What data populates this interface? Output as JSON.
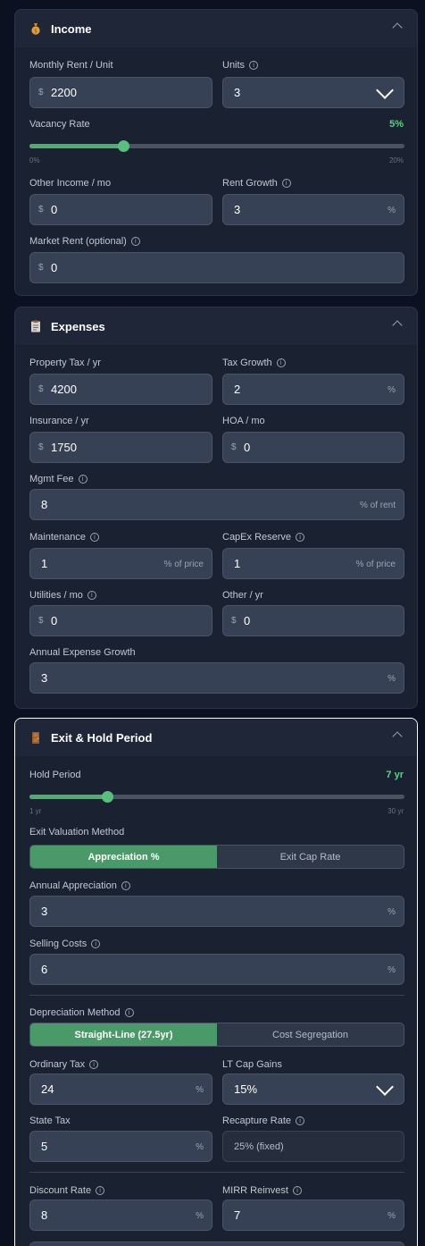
{
  "income": {
    "title": "Income",
    "icon": "money-bag-icon",
    "monthly_rent_label": "Monthly Rent / Unit",
    "monthly_rent_prefix": "$",
    "monthly_rent_value": "2200",
    "units_label": "Units",
    "units_value": "3",
    "vacancy_label": "Vacancy Rate",
    "vacancy_value_text": "5%",
    "vacancy_fraction": 0.25,
    "vacancy_min": "0%",
    "vacancy_max": "20%",
    "other_income_label": "Other Income / mo",
    "other_income_prefix": "$",
    "other_income_value": "0",
    "rent_growth_label": "Rent Growth",
    "rent_growth_value": "3",
    "rent_growth_suffix": "%",
    "market_rent_label": "Market Rent (optional)",
    "market_rent_prefix": "$",
    "market_rent_value": "0"
  },
  "expenses": {
    "title": "Expenses",
    "icon": "clipboard-icon",
    "property_tax_label": "Property Tax / yr",
    "property_tax_prefix": "$",
    "property_tax_value": "4200",
    "tax_growth_label": "Tax Growth",
    "tax_growth_value": "2",
    "tax_growth_suffix": "%",
    "insurance_label": "Insurance / yr",
    "insurance_prefix": "$",
    "insurance_value": "1750",
    "hoa_label": "HOA / mo",
    "hoa_prefix": "$",
    "hoa_value": "0",
    "mgmt_fee_label": "Mgmt Fee",
    "mgmt_fee_value": "8",
    "mgmt_fee_suffix": "% of rent",
    "maintenance_label": "Maintenance",
    "maintenance_value": "1",
    "maintenance_suffix": "% of price",
    "capex_label": "CapEx Reserve",
    "capex_value": "1",
    "capex_suffix": "% of price",
    "utilities_label": "Utilities / mo",
    "utilities_prefix": "$",
    "utilities_value": "0",
    "other_label": "Other / yr",
    "other_prefix": "$",
    "other_value": "0",
    "annual_growth_label": "Annual Expense Growth",
    "annual_growth_value": "3",
    "annual_growth_suffix": "%"
  },
  "exit": {
    "title": "Exit & Hold Period",
    "icon": "door-icon",
    "hold_label": "Hold Period",
    "hold_value_text": "7 yr",
    "hold_fraction": 0.207,
    "hold_min": "1 yr",
    "hold_max": "30 yr",
    "valuation_label": "Exit Valuation Method",
    "valuation_options": [
      "Appreciation %",
      "Exit Cap Rate"
    ],
    "appreciation_label": "Annual Appreciation",
    "appreciation_value": "3",
    "appreciation_suffix": "%",
    "selling_costs_label": "Selling Costs",
    "selling_costs_value": "6",
    "selling_costs_suffix": "%",
    "depreciation_label": "Depreciation Method",
    "depreciation_options": [
      "Straight-Line (27.5yr)",
      "Cost Segregation"
    ],
    "ordinary_tax_label": "Ordinary Tax",
    "ordinary_tax_value": "24",
    "ordinary_tax_suffix": "%",
    "lt_cap_label": "LT Cap Gains",
    "lt_cap_value": "15%",
    "state_tax_label": "State Tax",
    "state_tax_value": "5",
    "state_tax_suffix": "%",
    "recapture_label": "Recapture Rate",
    "recapture_value": "25% (fixed)",
    "discount_label": "Discount Rate",
    "discount_value": "8",
    "discount_suffix": "%",
    "mirr_label": "MIRR Reinvest",
    "mirr_value": "7",
    "mirr_suffix": "%"
  }
}
